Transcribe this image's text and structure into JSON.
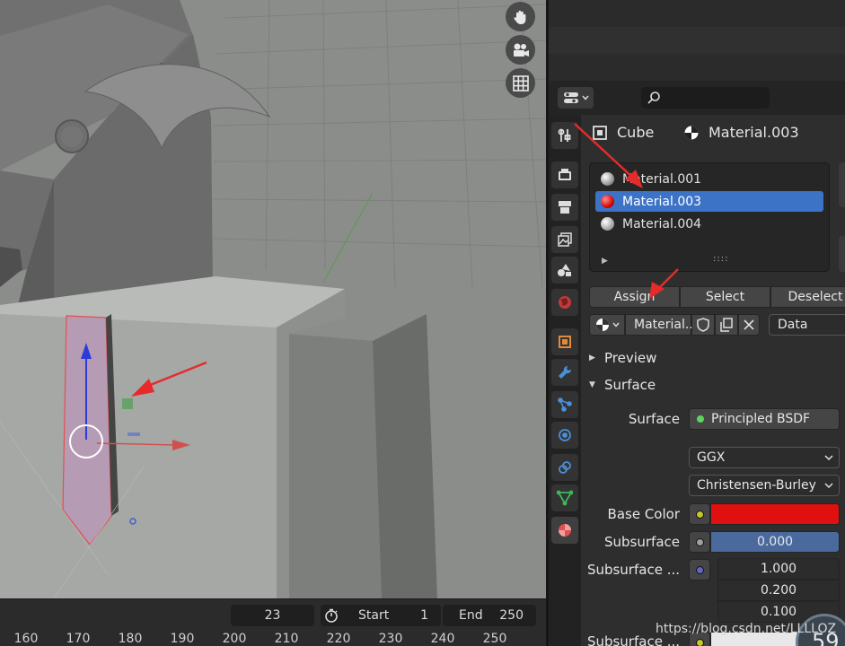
{
  "timeline": {
    "current_frame": "23",
    "start_label": "Start",
    "start_value": "1",
    "end_label": "End",
    "end_value": "250",
    "ruler_ticks": [
      "160",
      "170",
      "180",
      "190",
      "200",
      "210",
      "220",
      "230",
      "240",
      "250"
    ]
  },
  "properties": {
    "context": {
      "object_name": "Cube",
      "material_name": "Material.003"
    },
    "material_slots": [
      {
        "name": "Material.001",
        "selected": false,
        "color": "#c9c9c9"
      },
      {
        "name": "Material.003",
        "selected": true,
        "color": "#e01010"
      },
      {
        "name": "Material.004",
        "selected": false,
        "color": "#d4d4d4"
      }
    ],
    "slot_buttons": {
      "assign": "Assign",
      "select": "Select",
      "deselect": "Deselect"
    },
    "material_datablock": {
      "name": "Material...",
      "link": "Data"
    },
    "panels": {
      "preview": "Preview",
      "surface": "Surface"
    },
    "surface": {
      "surface_label": "Surface",
      "shader": "Principled BSDF",
      "distribution": "GGX",
      "subsurface_method": "Christensen-Burley",
      "base_color_label": "Base Color",
      "base_color": "#e01010",
      "subsurface_label": "Subsurface",
      "subsurface_value": "0.000",
      "subsurface_radius_label": "Subsurface ...",
      "subsurface_radius": [
        "1.000",
        "0.200",
        "0.100"
      ],
      "subsurface_color_label": "Subsurface ..."
    }
  },
  "overlay": {
    "watermark": "https://blog.csdn.net/LLLLOZ",
    "fps_value": "59"
  }
}
